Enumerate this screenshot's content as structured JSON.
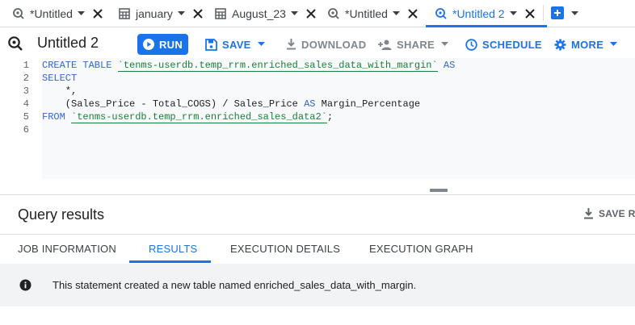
{
  "tabs": [
    {
      "label": "*Untitled",
      "icon": "query-icon",
      "active": false
    },
    {
      "label": "january",
      "icon": "table-icon",
      "active": false
    },
    {
      "label": "August_23",
      "icon": "table-icon",
      "active": false
    },
    {
      "label": "*Untitled",
      "icon": "query-icon",
      "active": false
    },
    {
      "label": "*Untitled 2",
      "icon": "query-icon",
      "active": true
    }
  ],
  "toolbar": {
    "title": "Untitled 2",
    "run_label": "RUN",
    "save_label": "SAVE",
    "download_label": "DOWNLOAD",
    "share_label": "SHARE",
    "schedule_label": "SCHEDULE",
    "more_label": "MORE"
  },
  "editor": {
    "line_numbers": [
      "1",
      "2",
      "3",
      "4",
      "5",
      "6"
    ],
    "line1_kw": "CREATE TABLE ",
    "line1_table": "`tenms-userdb.temp_rrm.enriched_sales_data_with_margin`",
    "line1_as": " AS",
    "line2": "SELECT",
    "line3": "    *,",
    "line4_a": "    (Sales_Price - Total_COGS) / Sales_Price ",
    "line4_as": "AS",
    "line4_b": " Margin_Percentage",
    "line5_kw": "FROM ",
    "line5_table": "`tenms-userdb.temp_rrm.enriched_sales_data2`",
    "line5_end": ";"
  },
  "results": {
    "title": "Query results",
    "save_results_label": "SAVE R",
    "tabs": [
      "JOB INFORMATION",
      "RESULTS",
      "EXECUTION DETAILS",
      "EXECUTION GRAPH"
    ],
    "active_tab": "RESULTS",
    "message": "This statement created a new table named enriched_sales_data_with_margin."
  },
  "colors": {
    "accent": "#1a73e8",
    "keyword": "#3367d6",
    "string": "#188038"
  }
}
